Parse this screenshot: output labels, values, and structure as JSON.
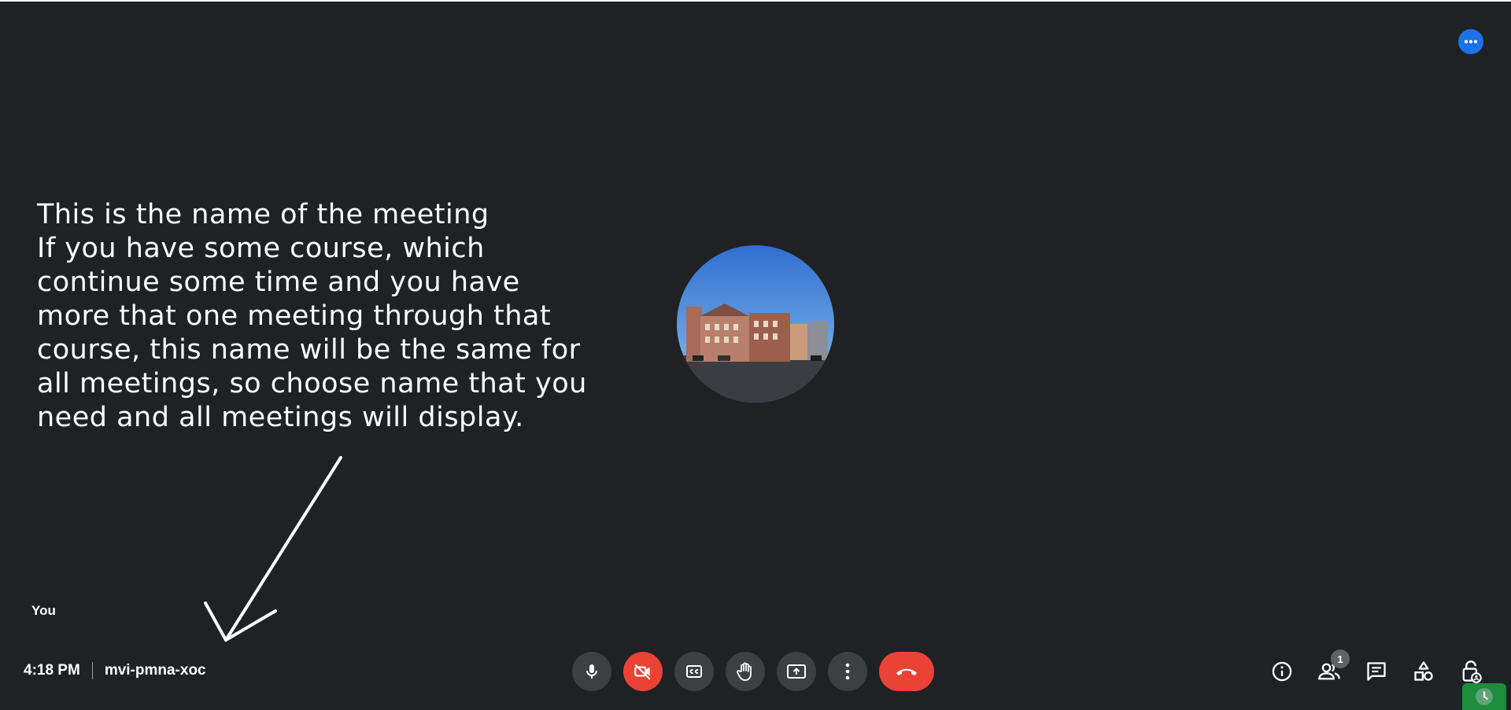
{
  "annotation": {
    "text": "This is the name of the meeting\nIf you have some course, which\ncontinue some time and you have\nmore that one meeting through that\ncourse, this name will be the same for\nall meetings, so choose name that you\nneed and all meetings will display."
  },
  "tile": {
    "self_label": "You"
  },
  "meeting": {
    "time": "4:18 PM",
    "code": "mvi-pmna-xoc"
  },
  "controls": {
    "buttons": [
      {
        "icon": "microphone-icon",
        "state": "on"
      },
      {
        "icon": "camera-off-icon",
        "state": "off",
        "color": "#ea4335"
      },
      {
        "icon": "captions-icon"
      },
      {
        "icon": "raise-hand-icon"
      },
      {
        "icon": "present-screen-icon"
      },
      {
        "icon": "more-options-icon"
      },
      {
        "icon": "end-call-icon",
        "color": "#ea4335"
      }
    ]
  },
  "side_controls": {
    "participants_count": "1",
    "icons": [
      "meeting-details-icon",
      "people-icon",
      "chat-icon",
      "activities-icon",
      "host-controls-icon"
    ]
  },
  "colors": {
    "background": "#202124",
    "button": "#3c4043",
    "danger": "#ea4335",
    "accent": "#1a73e8"
  }
}
